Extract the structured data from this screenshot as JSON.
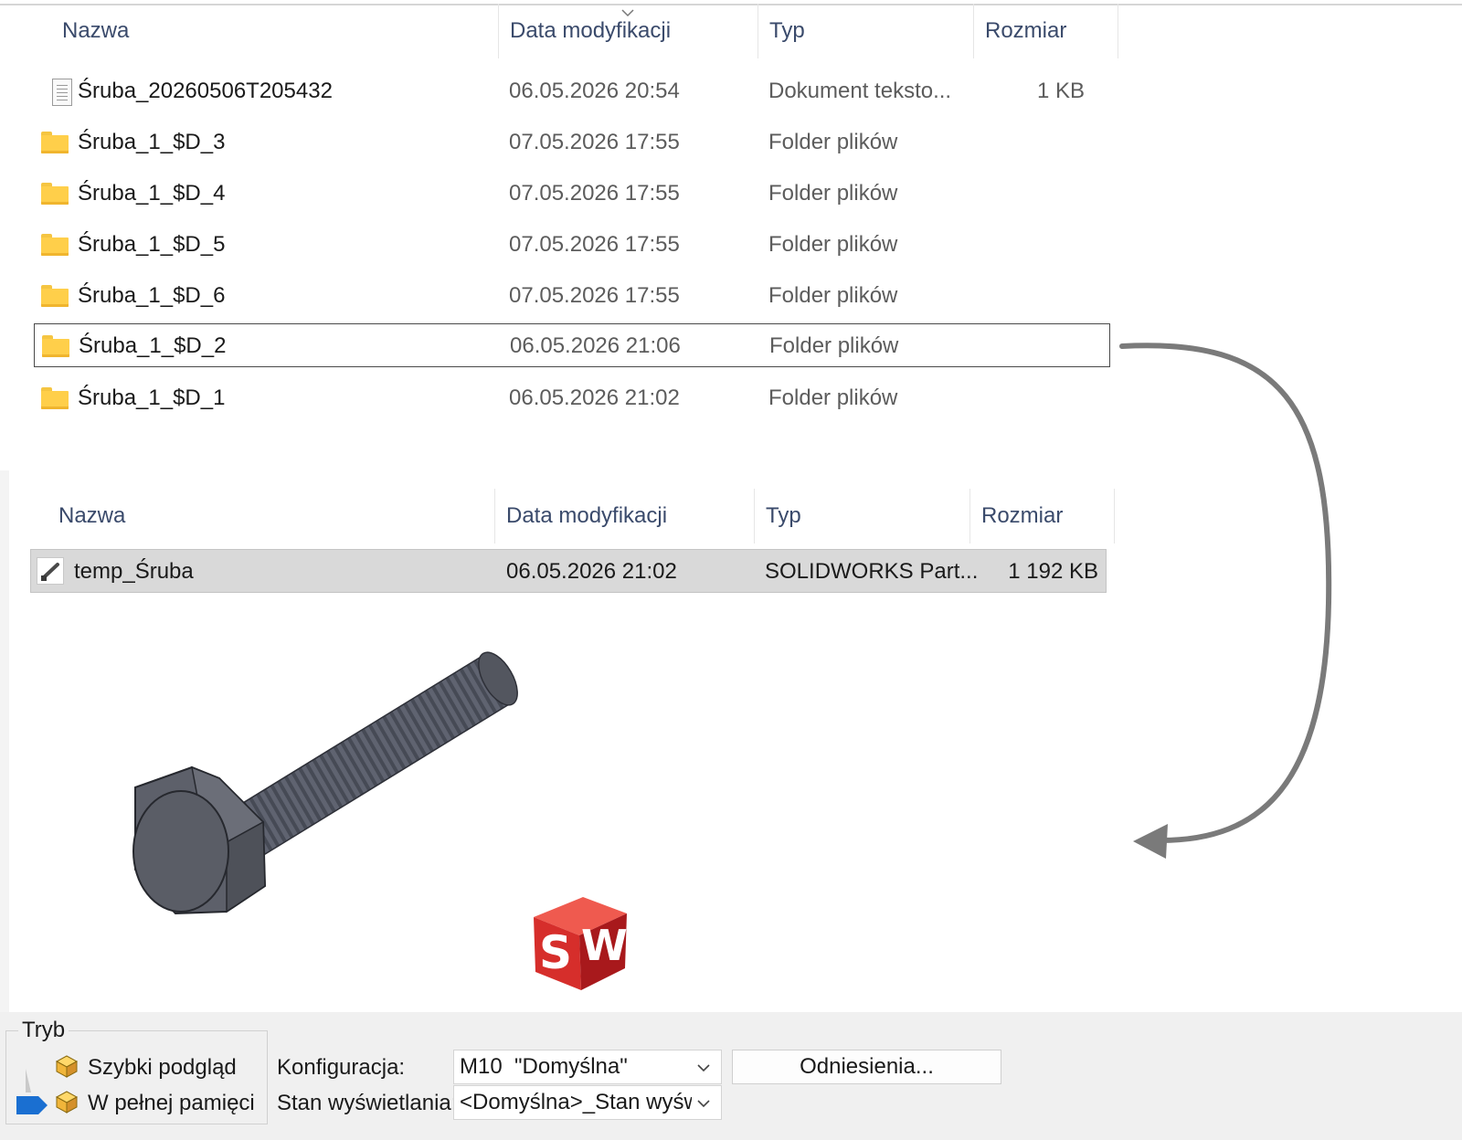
{
  "top_pane": {
    "columns": [
      "Nazwa",
      "Data modyfikacji",
      "Typ",
      "Rozmiar"
    ],
    "rows": [
      {
        "name": "Śruba_20260506T205432",
        "date": "06.05.2026 20:54",
        "type": "Dokument teksto...",
        "size": "1 KB",
        "icon": "text-document-icon"
      },
      {
        "name": "Śruba_1_$D_3",
        "date": "07.05.2026 17:55",
        "type": "Folder plików",
        "size": "",
        "icon": "folder-icon"
      },
      {
        "name": "Śruba_1_$D_4",
        "date": "07.05.2026 17:55",
        "type": "Folder plików",
        "size": "",
        "icon": "folder-icon"
      },
      {
        "name": "Śruba_1_$D_5",
        "date": "07.05.2026 17:55",
        "type": "Folder plików",
        "size": "",
        "icon": "folder-icon"
      },
      {
        "name": "Śruba_1_$D_6",
        "date": "07.05.2026 17:55",
        "type": "Folder plików",
        "size": "",
        "icon": "folder-icon"
      },
      {
        "name": "Śruba_1_$D_2",
        "date": "06.05.2026 21:06",
        "type": "Folder plików",
        "size": "",
        "icon": "folder-icon",
        "selected": true
      },
      {
        "name": "Śruba_1_$D_1",
        "date": "06.05.2026 21:02",
        "type": "Folder plików",
        "size": "",
        "icon": "folder-icon"
      }
    ]
  },
  "bottom_pane": {
    "columns": [
      "Nazwa",
      "Data modyfikacji",
      "Typ",
      "Rozmiar"
    ],
    "rows": [
      {
        "name": "temp_Śruba",
        "date": "06.05.2026 21:02",
        "type": "SOLIDWORKS Part...",
        "size": "1 192 KB",
        "icon": "solidworks-part-icon",
        "selected": true
      }
    ]
  },
  "mode_group": {
    "title": "Tryb",
    "options": [
      "Szybki podgląd",
      "W pełnej pamięci"
    ],
    "selected_index": 1
  },
  "config": {
    "label": "Konfiguracja:",
    "value": "M10  \"Domyślna\""
  },
  "display_state": {
    "label": "Stan wyświetlania:",
    "value": "<Domyślna>_Stan wyśw"
  },
  "references_button": "Odniesienia...",
  "logo": {
    "text_s": "S",
    "text_w": "W"
  },
  "colors": {
    "arrow": "#777777",
    "logo_red": "#d42a2a",
    "folder": "#ffcf4a",
    "selection_blue": "#1976d2"
  }
}
